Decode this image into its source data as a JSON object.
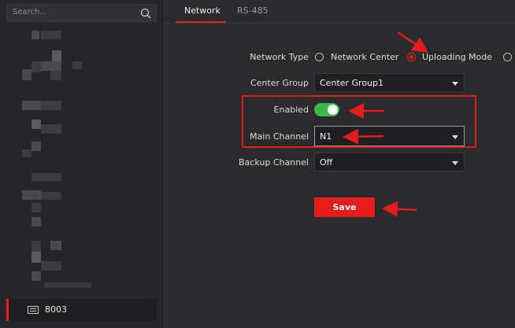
{
  "sidebar": {
    "search_placeholder": "Search...",
    "selected_device": "8003",
    "blurred_label": "Lab Terminal"
  },
  "tabs": [
    {
      "label": "Network",
      "active": true
    },
    {
      "label": "RS-485",
      "active": false
    }
  ],
  "form": {
    "network_type": {
      "label": "Network Type",
      "options": [
        "Network Center",
        "Uploading Mode",
        ""
      ],
      "selected": "Uploading Mode"
    },
    "center_group": {
      "label": "Center Group",
      "value": "Center Group1"
    },
    "enabled": {
      "label": "Enabled",
      "on": true
    },
    "main_channel": {
      "label": "Main Channel",
      "value": "N1"
    },
    "backup_channel": {
      "label": "Backup Channel",
      "value": "Off"
    },
    "save_label": "Save"
  },
  "colors": {
    "accent": "#e02020",
    "toggle_on": "#3cb84a",
    "save_button": "#e31c1c",
    "background": "#2b2b2e"
  }
}
